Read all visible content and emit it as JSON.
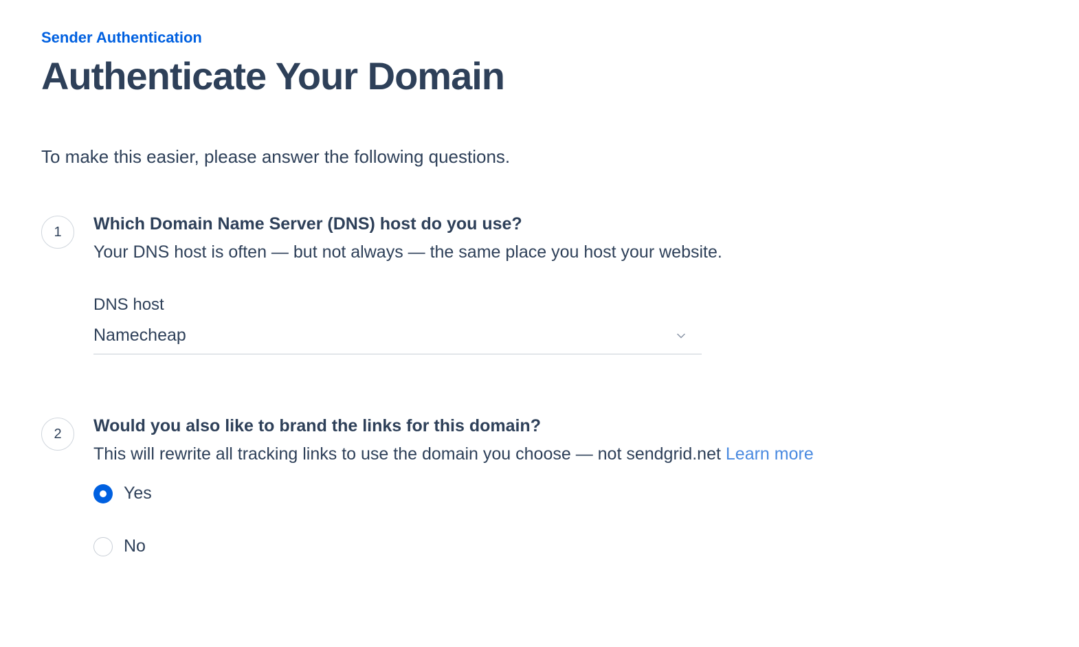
{
  "breadcrumb": "Sender Authentication",
  "page_title": "Authenticate Your Domain",
  "intro": "To make this easier, please answer the following questions.",
  "q1": {
    "number": "1",
    "title": "Which Domain Name Server (DNS) host do you use?",
    "desc": "Your DNS host is often — but not always — the same place you host your website.",
    "field_label": "DNS host",
    "selected_value": "Namecheap"
  },
  "q2": {
    "number": "2",
    "title": "Would you also like to brand the links for this domain?",
    "desc_main": "This will rewrite all tracking links to use the domain you choose — not sendgrid.net ",
    "learn_more": "Learn more",
    "yes_label": "Yes",
    "no_label": "No",
    "selected": "yes"
  }
}
